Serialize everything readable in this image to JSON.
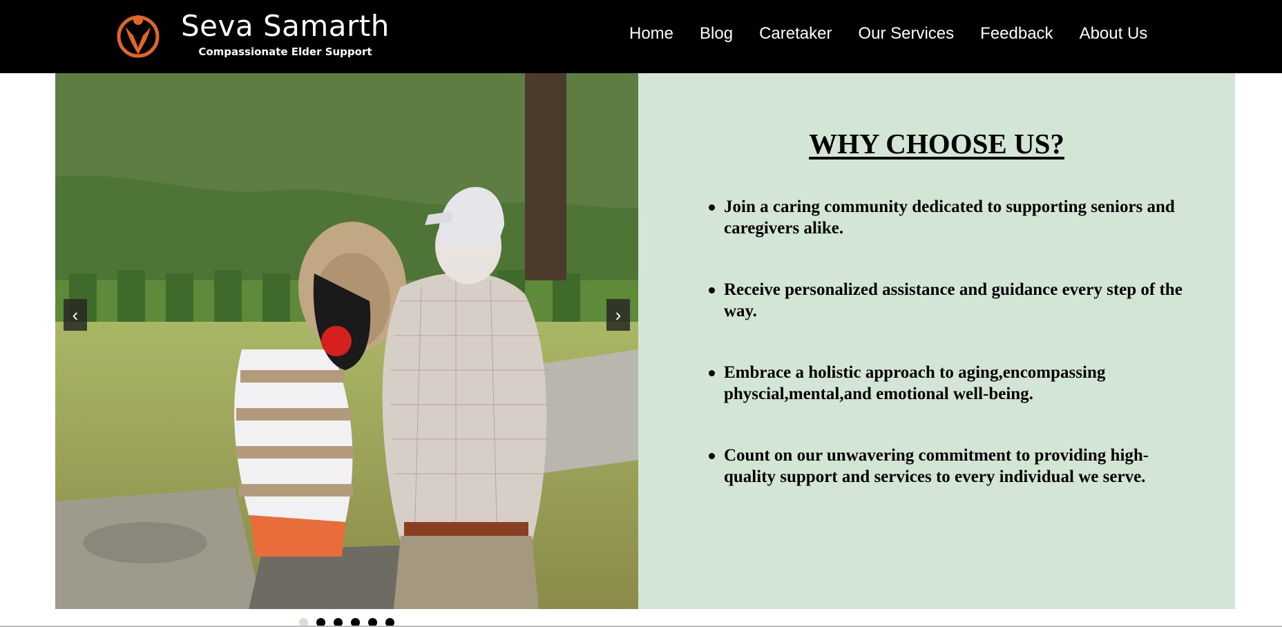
{
  "brand": {
    "name": "Seva Samarth",
    "tagline": "Compassionate Elder Support",
    "logo_icon": "person-heart-logo-icon",
    "logo_color": "#e0662a"
  },
  "nav": {
    "items": [
      {
        "label": "Home"
      },
      {
        "label": "Blog"
      },
      {
        "label": "Caretaker"
      },
      {
        "label": "Our Services"
      },
      {
        "label": "Feedback"
      },
      {
        "label": "About Us"
      }
    ]
  },
  "slider": {
    "prev_label": "‹",
    "next_label": "›",
    "image_subject": "elderly-couple-sitting-outdoors",
    "dot_count": 6,
    "active_dot": 1
  },
  "why": {
    "title": "WHY CHOOSE US?",
    "background": "#d3e5d4",
    "items": [
      {
        "text": "Join a caring community dedicated to supporting seniors and caregivers alike."
      },
      {
        "text": "Receive personalized assistance and guidance every step of the way."
      },
      {
        "text": "Embrace a holistic approach to aging,encompassing physcial,mental,and emotional well-being."
      },
      {
        "text": "Count on our unwavering commitment to providing high-quality support and services to every individual we serve."
      }
    ]
  }
}
